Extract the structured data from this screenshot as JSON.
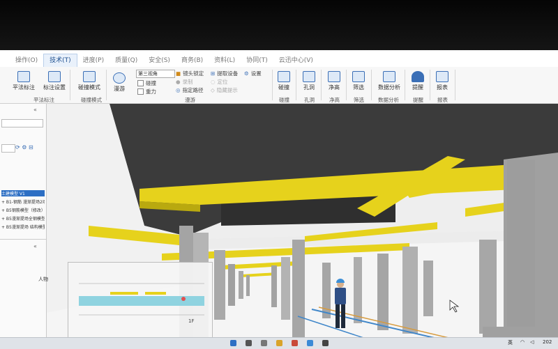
{
  "menu": {
    "items": [
      {
        "label": "操作(O)"
      },
      {
        "label": "技术(T)",
        "active": true
      },
      {
        "label": "进度(P)"
      },
      {
        "label": "质量(Q)"
      },
      {
        "label": "安全(S)"
      },
      {
        "label": "商务(B)"
      },
      {
        "label": "资料(L)"
      },
      {
        "label": "协同(T)"
      },
      {
        "label": "云迅中心(V)"
      }
    ]
  },
  "ribbon": {
    "btn_plan_mark": "平法标注",
    "btn_mark_settings": "标注设置",
    "grp_plan_mark": "平法标注",
    "btn_collision_mode": "碰撞模式",
    "grp_collision_mode": "碰撞模式",
    "btn_roam": "漫游",
    "view_select": "第三视角",
    "chk_collision": "碰撞",
    "chk_gravity": "重力",
    "opt_lock_camera": "镜头锁定",
    "opt_record": "录制",
    "opt_set_path": "指定路径",
    "opt_pick_device": "提取设备",
    "opt_locate": "定位",
    "opt_hide_tip": "隐藏提示",
    "btn_settings": "设置",
    "grp_roam": "漫游",
    "btn_collision": "碰撞",
    "grp_collision": "碰撞",
    "btn_hole": "孔洞",
    "grp_hole": "孔洞",
    "btn_clear_height": "净高",
    "grp_clear_height": "净高",
    "btn_filter": "筛选",
    "grp_filter": "筛选",
    "btn_data_analysis": "数据分析",
    "grp_data_analysis": "数据分析",
    "btn_reminder": "提醒",
    "grp_reminder": "提醒",
    "btn_report": "报表",
    "grp_report": "报表"
  },
  "left_panel": {
    "collapse_glyph": "«",
    "tree_items": [
      "土建模型 V1",
      "+ B1-钢筋 漫渐提场2场模...",
      "+ B5钢筋模型（修改）1.V",
      "+ B5漫渐提场全钢模型",
      "+ B5漫渐提场 结构模型"
    ],
    "person_label": "人物"
  },
  "viewport": {
    "colors": {
      "beam": "#e6d21c",
      "beam_side": "#b9a90f",
      "column": "#a9a9a9",
      "column_dark": "#8a8a8a",
      "ceiling": "#3a3a3a",
      "floor": "#f4f4f4",
      "pipe_blue": "#3f86c9",
      "pipe_orange": "#d79a3b"
    },
    "minimap_label": "1F"
  },
  "taskbar": {
    "lang": "英",
    "time_fragment": "202"
  }
}
